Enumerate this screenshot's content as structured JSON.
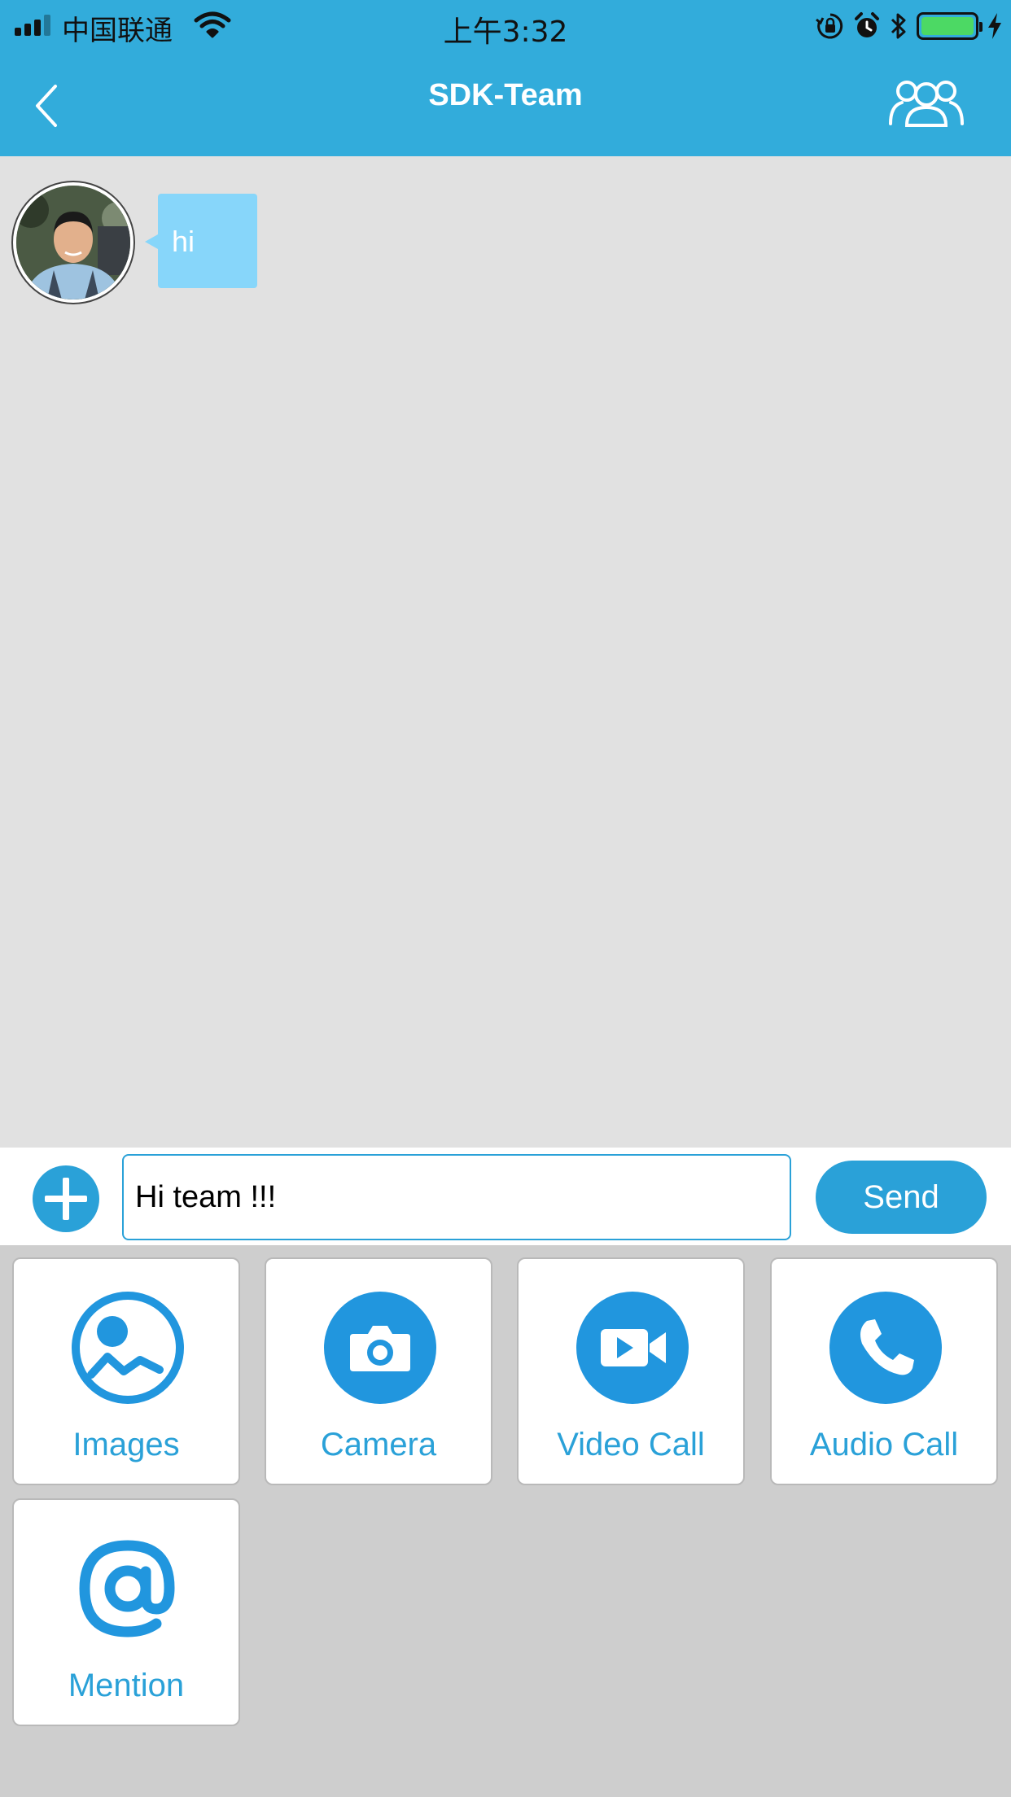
{
  "status_bar": {
    "carrier": "中国联通",
    "time": "上午3:32",
    "battery_color": "#4cd964"
  },
  "nav": {
    "title": "SDK-Team",
    "back_icon": "chevron-left-icon",
    "members_icon": "group-icon"
  },
  "chat": {
    "messages": [
      {
        "sender": "avatar",
        "text": "hi"
      }
    ]
  },
  "composer": {
    "value": "Hi team !!!",
    "send_label": "Send",
    "attach_icon": "plus-circle-icon"
  },
  "actions": [
    {
      "label": "Images",
      "icon": "image-icon"
    },
    {
      "label": "Camera",
      "icon": "camera-icon"
    },
    {
      "label": "Video Call",
      "icon": "video-call-icon"
    },
    {
      "label": "Audio Call",
      "icon": "phone-icon"
    },
    {
      "label": "Mention",
      "icon": "at-icon"
    }
  ],
  "colors": {
    "accent": "#2aa1d8",
    "nav_bar": "#32acdb",
    "bubble": "#87d6fa",
    "chat_bg": "#e1e1e1",
    "panel_bg": "#cecece"
  }
}
